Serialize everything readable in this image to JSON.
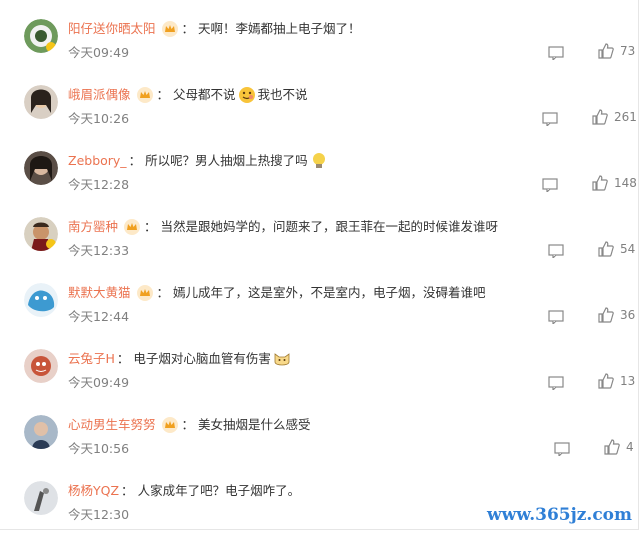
{
  "comments": [
    {
      "user": "阳仔送你晒太阳",
      "text": "天啊！李嫣都抽上电子烟了！",
      "time": "今天09:49",
      "likes": "73",
      "avatar_color": "#5a8a4a",
      "emoji": ""
    },
    {
      "user": "峨眉派偶像",
      "text": "父母都不说",
      "text2": "我也不说",
      "time": "今天10:26",
      "likes": "261",
      "avatar_color": "#3c3028",
      "emoji": "face"
    },
    {
      "user": "Zebbory_",
      "text": "所以呢？男人抽烟上热搜了吗",
      "time": "今天12:28",
      "likes": "148",
      "avatar_color": "#4b4038",
      "emoji": "bulb"
    },
    {
      "user": "南方罂种",
      "text": "当然是跟她妈学的，问题来了，跟王菲在一起的时候谁发谁呀",
      "time": "今天12:33",
      "likes": "54",
      "avatar_color": "#8a7050",
      "emoji": ""
    },
    {
      "user": "默默大黄猫",
      "text": "嫣儿成年了，这是室外，不是室内，电子烟，没碍着谁吧",
      "time": "今天12:44",
      "likes": "36",
      "avatar_color": "#3d9ad1",
      "emoji": ""
    },
    {
      "user": "云兔子H",
      "text": "电子烟对心脑血管有伤害",
      "time": "今天09:49",
      "likes": "13",
      "avatar_color": "#c8553a",
      "emoji": "cat"
    },
    {
      "user": "心动男生车努努",
      "text": "美女抽烟是什么感受",
      "time": "今天10:56",
      "likes": "4",
      "avatar_color": "#2a3b55",
      "emoji": ""
    },
    {
      "user": "杨杨YQZ",
      "text": "人家成年了吧？电子烟咋了。",
      "time": "今天12:30",
      "likes": "",
      "avatar_color": "#c9ccd0",
      "emoji": ""
    }
  ],
  "watermark": "www.365jz.com",
  "colors": {
    "username": "#eb7350",
    "text": "#333333",
    "meta": "#808080"
  }
}
